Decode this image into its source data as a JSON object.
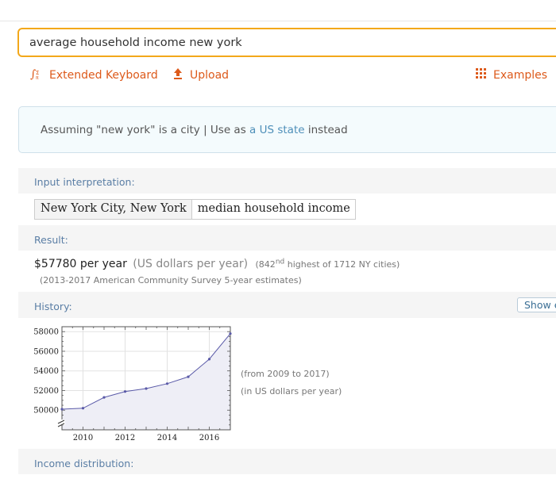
{
  "search": {
    "query": "average household income new york"
  },
  "tools": {
    "extended_keyboard": "Extended Keyboard",
    "upload": "Upload",
    "examples": "Examples"
  },
  "assumption": {
    "prefix": "Assuming \"new york\" is a city | Use as",
    "link": "a US state",
    "suffix": "instead"
  },
  "pods": {
    "input": {
      "title": "Input interpretation:",
      "place": "New York City, New York",
      "property": "median household income"
    },
    "result": {
      "title": "Result:",
      "value": "$57780 per year",
      "unit": "(US dollars per year)",
      "rank_pre": "(842",
      "rank_sup": "nd",
      "rank_post": "highest of 1712 NY cities)",
      "source": "(2013-2017 American Community Survey 5-year estimates)"
    },
    "history": {
      "title": "History:",
      "show_button": "Show e",
      "note1": "(from 2009 to 2017)",
      "note2": "(in US dollars per year)"
    },
    "distribution": {
      "title": "Income distribution:"
    }
  },
  "chart_data": {
    "type": "line",
    "x": [
      2009,
      2010,
      2011,
      2012,
      2013,
      2014,
      2015,
      2016,
      2017
    ],
    "series": [
      {
        "values": [
          50100,
          50200,
          51300,
          51900,
          52200,
          52700,
          53400,
          55200,
          57800
        ]
      }
    ],
    "xticks": [
      "2010",
      "2012",
      "2014",
      "2016"
    ],
    "yticks": [
      "50000",
      "52000",
      "54000",
      "56000",
      "58000"
    ],
    "xlim": [
      2009,
      2017
    ],
    "ylim": [
      48000,
      58500
    ],
    "axis_break": true,
    "grid": true,
    "colors": {
      "line": "#5a5aa8",
      "fill": "#eeeef6",
      "accent": "#dd5a1b"
    }
  }
}
